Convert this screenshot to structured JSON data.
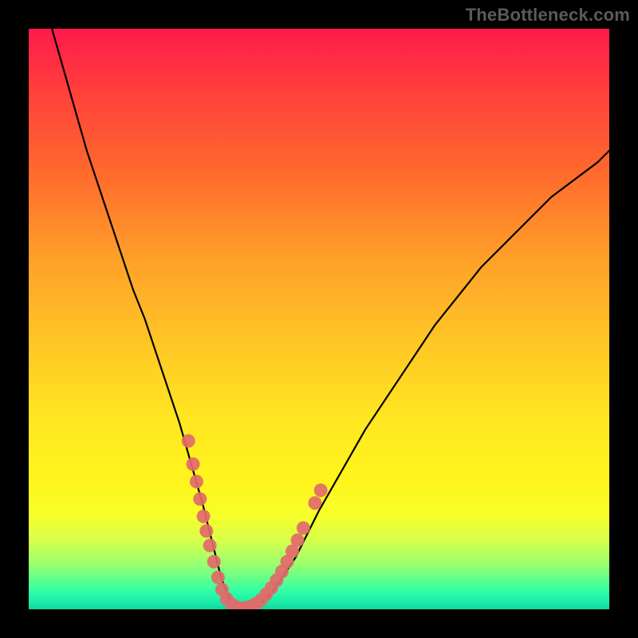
{
  "watermark": "TheBottleneck.com",
  "chart_data": {
    "type": "line",
    "title": "",
    "xlabel": "",
    "ylabel": "",
    "xlim": [
      0,
      100
    ],
    "ylim": [
      0,
      100
    ],
    "grid": false,
    "legend": false,
    "curve_color": "#000000",
    "marker_color": "#e26a6a",
    "series": [
      {
        "name": "curve",
        "x": [
          4,
          6,
          8,
          10,
          12,
          14,
          16,
          18,
          20,
          22,
          24,
          26,
          28,
          30,
          31,
          32,
          33,
          34,
          35,
          36,
          38,
          40,
          42,
          44,
          46,
          48,
          50,
          54,
          58,
          62,
          66,
          70,
          74,
          78,
          82,
          86,
          90,
          94,
          98,
          100
        ],
        "y": [
          100,
          93,
          86,
          79,
          73,
          67,
          61,
          55,
          50,
          44,
          38,
          32,
          25,
          18,
          14,
          10,
          6,
          3,
          1,
          0,
          0,
          1,
          3,
          6,
          9,
          13,
          17,
          24,
          31,
          37,
          43,
          49,
          54,
          59,
          63,
          67,
          71,
          74,
          77,
          79
        ]
      }
    ],
    "markers": [
      {
        "x": 27.5,
        "y": 29
      },
      {
        "x": 28.3,
        "y": 25
      },
      {
        "x": 28.9,
        "y": 22
      },
      {
        "x": 29.5,
        "y": 19
      },
      {
        "x": 30.1,
        "y": 16
      },
      {
        "x": 30.6,
        "y": 13.5
      },
      {
        "x": 31.2,
        "y": 11
      },
      {
        "x": 31.9,
        "y": 8.2
      },
      {
        "x": 32.6,
        "y": 5.5
      },
      {
        "x": 33.3,
        "y": 3.4
      },
      {
        "x": 34.1,
        "y": 1.8
      },
      {
        "x": 35.0,
        "y": 0.8
      },
      {
        "x": 36.0,
        "y": 0.3
      },
      {
        "x": 37.0,
        "y": 0.2
      },
      {
        "x": 38.0,
        "y": 0.4
      },
      {
        "x": 39.0,
        "y": 0.9
      },
      {
        "x": 40.0,
        "y": 1.6
      },
      {
        "x": 40.9,
        "y": 2.6
      },
      {
        "x": 41.8,
        "y": 3.7
      },
      {
        "x": 42.7,
        "y": 5.0
      },
      {
        "x": 43.6,
        "y": 6.5
      },
      {
        "x": 44.5,
        "y": 8.2
      },
      {
        "x": 45.4,
        "y": 10.0
      },
      {
        "x": 46.3,
        "y": 11.9
      },
      {
        "x": 47.3,
        "y": 14.0
      },
      {
        "x": 49.3,
        "y": 18.3
      },
      {
        "x": 50.3,
        "y": 20.5
      }
    ]
  }
}
